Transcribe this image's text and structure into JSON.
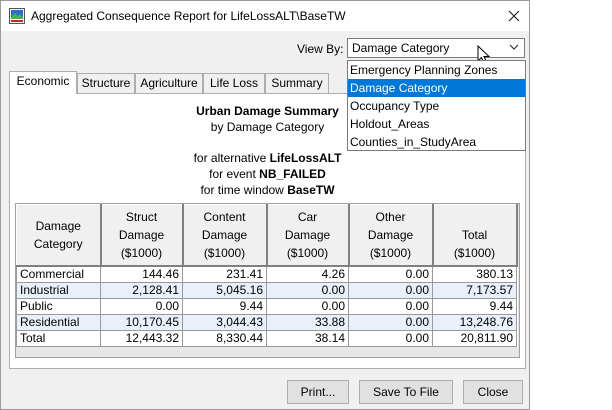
{
  "window": {
    "title": "Aggregated Consequence Report for LifeLossALT\\BaseTW"
  },
  "view_by": {
    "label": "View By:",
    "selected": "Damage Category",
    "options": [
      "Emergency Planning Zones",
      "Damage Category",
      "Occupancy Type",
      "Holdout_Areas",
      "Counties_in_StudyArea"
    ],
    "highlighted_index": 1
  },
  "tabs": [
    "Economic",
    "Structure",
    "Agriculture",
    "Life Loss",
    "Summary"
  ],
  "active_tab": 0,
  "summary": {
    "title": "Urban Damage Summary",
    "subtitle": "by Damage Category",
    "alt_prefix": "for alternative",
    "alt_value": "LifeLossALT",
    "event_prefix": "for event",
    "event_value": "NB_FAILED",
    "tw_prefix": "for time window",
    "tw_value": "BaseTW"
  },
  "table": {
    "columns": [
      [
        "Damage",
        "Category"
      ],
      [
        "Struct",
        "Damage",
        "($1000)"
      ],
      [
        "Content",
        "Damage",
        "($1000)"
      ],
      [
        "Car",
        "Damage",
        "($1000)"
      ],
      [
        "Other",
        "Damage",
        "($1000)"
      ],
      [
        "Total",
        "($1000)"
      ]
    ],
    "rows": [
      [
        "Commercial",
        "144.46",
        "231.41",
        "4.26",
        "0.00",
        "380.13"
      ],
      [
        "Industrial",
        "2,128.41",
        "5,045.16",
        "0.00",
        "0.00",
        "7,173.57"
      ],
      [
        "Public",
        "0.00",
        "9.44",
        "0.00",
        "0.00",
        "9.44"
      ],
      [
        "Residential",
        "10,170.45",
        "3,044.43",
        "33.88",
        "0.00",
        "13,248.76"
      ],
      [
        "Total",
        "12,443.32",
        "8,330.44",
        "38.14",
        "0.00",
        "20,811.90"
      ]
    ]
  },
  "buttons": {
    "print": "Print...",
    "save": "Save To File",
    "close": "Close"
  }
}
